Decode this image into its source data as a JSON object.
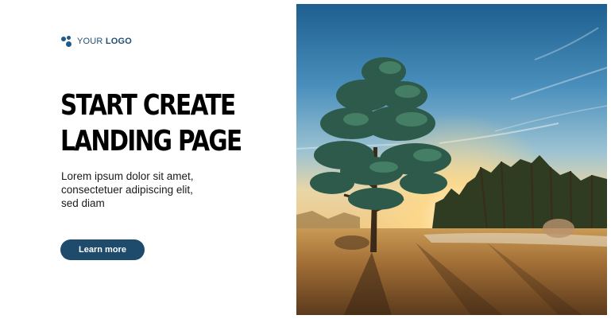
{
  "logo": {
    "icon": "three-dots-logo-icon",
    "text_light": "YOUR ",
    "text_bold": "LOGO",
    "color": "#1f5a8a"
  },
  "hero": {
    "headline_line1": "START CREATE",
    "headline_line2": "LANDING PAGE",
    "description_line1": "Lorem ipsum dolor sit amet,",
    "description_line2": "consectetuer adipiscing elit,",
    "description_line3": "sed diam",
    "cta_label": "Learn more",
    "cta_color": "#1e4a6c"
  },
  "photo": {
    "subject": "pine-tree-at-sunrise-photo"
  }
}
